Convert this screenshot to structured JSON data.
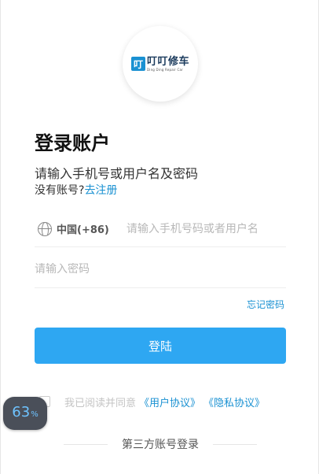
{
  "logo": {
    "mark": "叮",
    "name": "叮叮修车",
    "tagline": "Ding Ding Repair Car"
  },
  "login": {
    "title": "登录账户",
    "subtitle": "请输入手机号或用户名及密码",
    "no_account": "没有账号?",
    "register_link": "去注册",
    "country_code": "中国(+86)",
    "phone_placeholder": "请输入手机号码或者用户名",
    "password_placeholder": "请输入密码",
    "forgot_password": "忘记密码",
    "login_button": "登陆",
    "agree_prefix": "我已阅读并同意",
    "user_agreement": "《用户协议》",
    "privacy_policy": "《隐私协议》",
    "third_party": "第三方账号登录"
  },
  "overlay": {
    "zoom_value": "63",
    "zoom_unit": "%"
  },
  "colors": {
    "accent": "#1a91d2",
    "button": "#2ea7f2",
    "badge_bg": "#4a4f59"
  },
  "icons": {
    "country": "globe-icon"
  }
}
